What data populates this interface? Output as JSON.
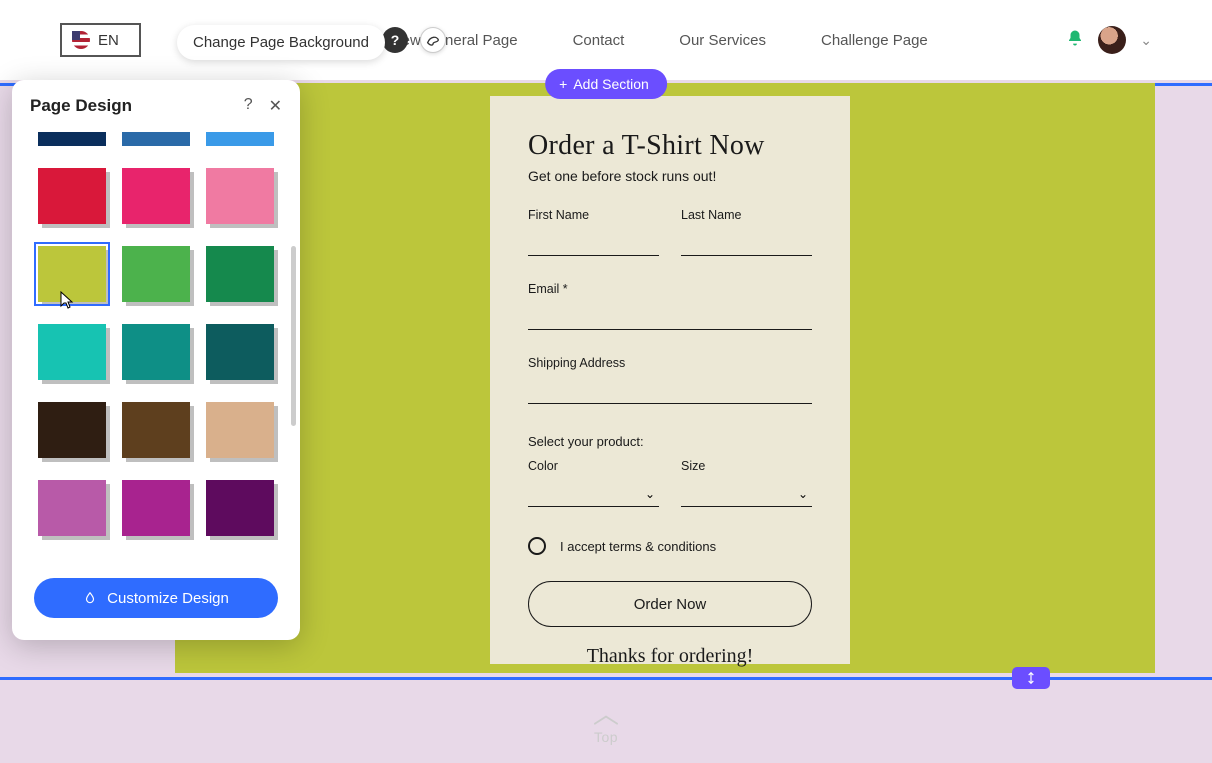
{
  "header": {
    "lang_label": "EN",
    "nav": [
      "New General Page",
      "Contact",
      "Our Services",
      "Challenge Page"
    ]
  },
  "tooltip": {
    "change_bg": "Change Page Background"
  },
  "add_section_label": "Add Section",
  "panel": {
    "title": "Page Design",
    "customize_btn": "Customize Design",
    "swatches": [
      [
        "#0a2e5c",
        "#2a6aa8",
        "#3a9ae8"
      ],
      [
        "#d9183a",
        "#e8246c",
        "#f07aa2"
      ],
      [
        "#bcc63b",
        "#4cb24c",
        "#15894d"
      ],
      [
        "#17c3b2",
        "#0e8f86",
        "#0d5c5e"
      ],
      [
        "#2f1e12",
        "#5e3f1e",
        "#d9b08c"
      ],
      [
        "#b85aa8",
        "#a8238f",
        "#5e0b5e"
      ]
    ],
    "selected": [
      2,
      0
    ]
  },
  "form": {
    "title": "Order a T-Shirt Now",
    "subtitle": "Get one before stock runs out!",
    "first_name_label": "First Name",
    "last_name_label": "Last Name",
    "email_label": "Email *",
    "address_label": "Shipping Address",
    "product_label": "Select your product:",
    "color_label": "Color",
    "size_label": "Size",
    "terms_label": "I accept terms & conditions",
    "submit_label": "Order Now",
    "thanks": "Thanks for ordering!"
  },
  "footer": {
    "top_label": "Top"
  }
}
